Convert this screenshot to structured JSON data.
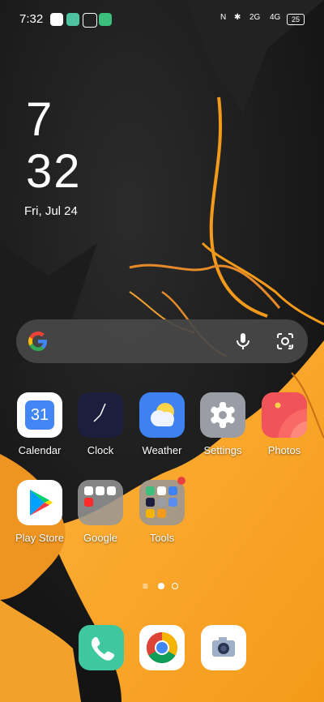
{
  "status_bar": {
    "time": "7:32",
    "signal_2g": "2G",
    "signal_4g": "4G",
    "battery": "25"
  },
  "clock_widget": {
    "hours": "7",
    "minutes": "32",
    "date": "Fri, Jul 24"
  },
  "apps_row1": [
    {
      "label": "Calendar",
      "icon": "calendar-icon",
      "day": "31",
      "color": "#ffffff"
    },
    {
      "label": "Clock",
      "icon": "clock-icon",
      "color": "#1b1e3d"
    },
    {
      "label": "Weather",
      "icon": "weather-icon",
      "color": "#3d82f0"
    },
    {
      "label": "Settings",
      "icon": "gear-icon",
      "color": "#9a9ca6"
    },
    {
      "label": "Photos",
      "icon": "photos-icon",
      "color": "#f0545a"
    }
  ],
  "apps_row2": [
    {
      "label": "Play Store",
      "icon": "play-store-icon",
      "color": "#ffffff"
    },
    {
      "label": "Google",
      "icon": "folder-icon",
      "color": "#9a9a9a"
    },
    {
      "label": "Tools",
      "icon": "folder-icon",
      "color": "#9a9a9a"
    }
  ],
  "dock": [
    {
      "icon": "phone-icon",
      "color": "#3fc8a0"
    },
    {
      "icon": "chrome-icon",
      "color": "#ffffff"
    },
    {
      "icon": "camera-icon",
      "color": "#ffffff"
    }
  ],
  "colors": {
    "accent_orange": "#f39a1a",
    "notification_dot": "#e8413f"
  }
}
